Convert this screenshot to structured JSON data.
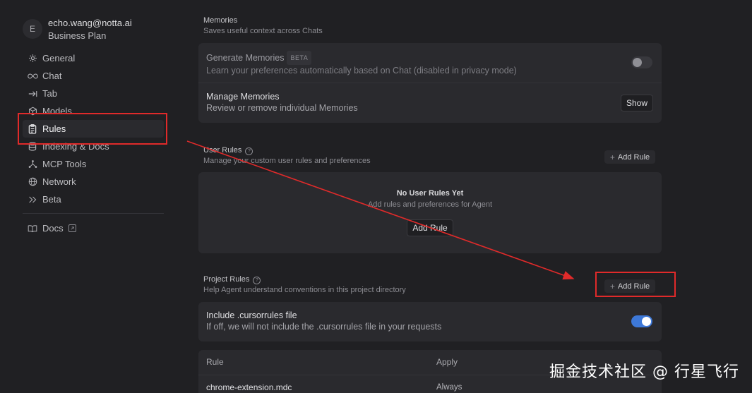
{
  "account": {
    "avatar_letter": "E",
    "email": "echo.wang@notta.ai",
    "plan": "Business Plan"
  },
  "sidebar": {
    "items": [
      {
        "label": "General",
        "icon": "gear-icon"
      },
      {
        "label": "Chat",
        "icon": "infinity-icon"
      },
      {
        "label": "Tab",
        "icon": "tab-arrow-icon"
      },
      {
        "label": "Models",
        "icon": "cube-icon"
      },
      {
        "label": "Rules",
        "icon": "clipboard-icon",
        "active": true
      },
      {
        "label": "Indexing & Docs",
        "icon": "database-icon"
      },
      {
        "label": "MCP Tools",
        "icon": "hub-icon"
      },
      {
        "label": "Network",
        "icon": "globe-icon"
      },
      {
        "label": "Beta",
        "icon": "double-chevron-icon"
      }
    ],
    "docs_label": "Docs"
  },
  "memories": {
    "title": "Memories",
    "subtitle": "Saves useful context across Chats",
    "generate": {
      "title": "Generate Memories",
      "badge": "BETA",
      "subtitle": "Learn your preferences automatically based on Chat (disabled in privacy mode)",
      "enabled": false
    },
    "manage": {
      "title": "Manage Memories",
      "subtitle": "Review or remove individual Memories",
      "button": "Show"
    }
  },
  "user_rules": {
    "title": "User Rules",
    "subtitle": "Manage your custom user rules and preferences",
    "add_label": "Add Rule",
    "empty_title": "No User Rules Yet",
    "empty_subtitle": "Add rules and preferences for Agent",
    "empty_button": "Add Rule"
  },
  "project_rules": {
    "title": "Project Rules",
    "subtitle": "Help Agent understand conventions in this project directory",
    "add_label": "Add Rule",
    "include_title": "Include .cursorrules file",
    "include_subtitle": "If off, we will not include the .cursorrules file in your requests",
    "include_enabled": true,
    "table": {
      "headers": [
        "Rule",
        "Apply"
      ],
      "rows": [
        {
          "rule": "chrome-extension.mdc",
          "apply": "Always"
        }
      ]
    }
  },
  "watermark": "掘金技术社区 @ 行星飞行",
  "colors": {
    "annotation": "#e02a2a",
    "toggle_on": "#3d78d8"
  }
}
